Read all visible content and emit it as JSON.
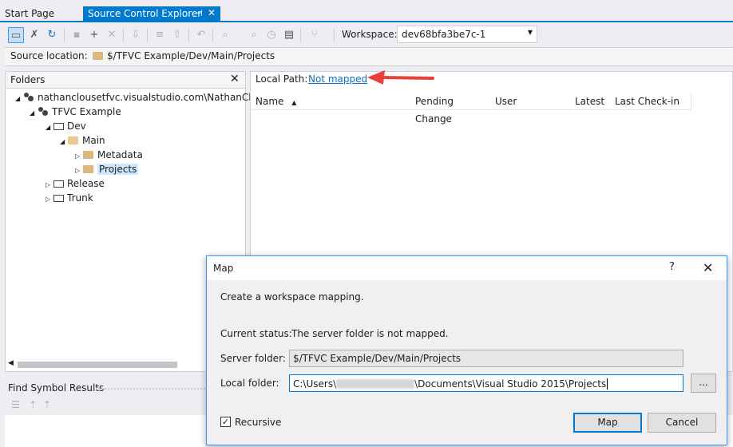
{
  "tabs": [
    {
      "label": "Start Page"
    },
    {
      "label": "Source Control Explorer",
      "pin": "⊣",
      "close": "✕"
    }
  ],
  "toolbar": {
    "workspace_label": "Workspace:",
    "workspace_value": "dev68bfa3be7c-1",
    "icons": [
      "folder-icon",
      "disconnect-icon",
      "refresh-icon",
      "new-folder-icon",
      "add-items-icon",
      "delete-icon",
      "get-latest-icon",
      "pending-changes-icon",
      "check-in-icon",
      "undo-icon",
      "find-icon",
      "compare-icon",
      "history-icon",
      "view-history-icon",
      "branching-icon"
    ]
  },
  "source_location": {
    "label": "Source location:",
    "value": "$/TFVC Example/Dev/Main/Projects"
  },
  "folders": {
    "title": "Folders",
    "close": "✕",
    "tree": [
      {
        "label": "nathanclousetfvc.visualstudio.com\\NathanClous",
        "level": 0,
        "expanded": true,
        "icon": "team-icon"
      },
      {
        "label": "TFVC Example",
        "level": 1,
        "expanded": true,
        "icon": "team-icon"
      },
      {
        "label": "Dev",
        "level": 2,
        "expanded": true,
        "icon": "branch-icon"
      },
      {
        "label": "Main",
        "level": 3,
        "expanded": true,
        "icon": "folder-open-icon"
      },
      {
        "label": "Metadata",
        "level": 4,
        "expanded": false,
        "icon": "folder-icon"
      },
      {
        "label": "Projects",
        "level": 4,
        "expanded": false,
        "icon": "folder-icon",
        "selected": true
      },
      {
        "label": "Release",
        "level": 2,
        "expanded": false,
        "icon": "branch-icon"
      },
      {
        "label": "Trunk",
        "level": 2,
        "expanded": false,
        "icon": "branch-icon"
      }
    ]
  },
  "local_path": {
    "label": "Local Path:",
    "value": "Not mapped"
  },
  "columns": [
    "Name",
    "Pending Change",
    "User",
    "Latest",
    "Last Check-in"
  ],
  "find_symbol": {
    "title": "Find Symbol Results"
  },
  "dialog": {
    "title": "Map",
    "help": "?",
    "close": "✕",
    "intro": "Create a workspace mapping.",
    "status_label": "Current status:",
    "status_value": "The server folder is not mapped.",
    "server_label": "Server folder:",
    "server_value": "$/TFVC Example/Dev/Main/Projects",
    "local_label": "Local folder:",
    "local_prefix": "C:\\Users\\",
    "local_suffix": "\\Documents\\Visual Studio 2015\\Projects",
    "browse": "...",
    "recursive_label": "Recursive",
    "recursive_checked": "✓",
    "map_button": "Map",
    "cancel_button": "Cancel"
  },
  "colors": {
    "accent": "#007acc",
    "link": "#0e70c0",
    "annotation_arrow": "#e8413c"
  }
}
